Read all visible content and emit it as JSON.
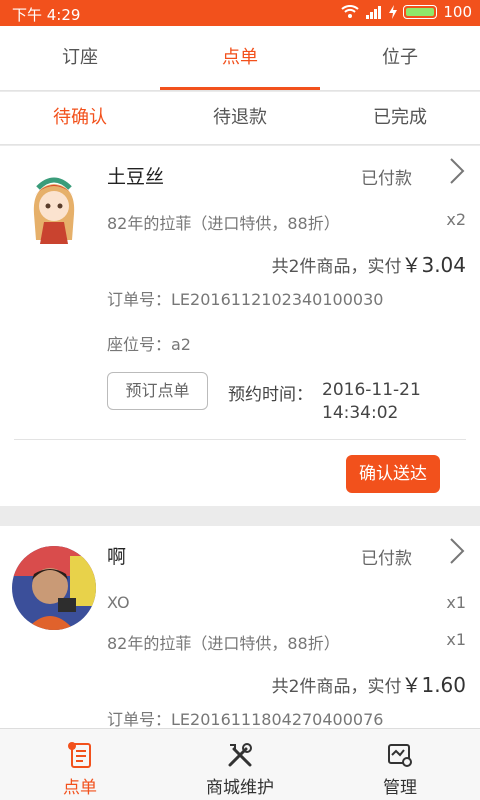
{
  "status_bar": {
    "time": "下午 4:29",
    "battery": "100"
  },
  "top_tabs": [
    {
      "label": "订座",
      "active": false
    },
    {
      "label": "点单",
      "active": true
    },
    {
      "label": "位子",
      "active": false
    }
  ],
  "sub_tabs": [
    {
      "label": "待确认",
      "active": true
    },
    {
      "label": "待退款",
      "active": false
    },
    {
      "label": "已完成",
      "active": false
    }
  ],
  "orders": [
    {
      "name": "土豆丝",
      "status": "已付款",
      "items": [
        {
          "title": "82年的拉菲（进口特供，88折）",
          "qty": "x2"
        }
      ],
      "summary_prefix": "共2件商品，实付",
      "amount": "￥3.04",
      "order_no": "订单号：LE2016112102340100030",
      "seat": "座位号：a2",
      "tag": "预订点单",
      "appt_label": "预约时间：",
      "appt_date": "2016-11-21",
      "appt_time": "14:34:02",
      "confirm": "确认送达"
    },
    {
      "name": "啊",
      "status": "已付款",
      "items": [
        {
          "title": "XO",
          "qty": "x1"
        },
        {
          "title": "82年的拉菲（进口特供，88折）",
          "qty": "x1"
        }
      ],
      "summary_prefix": "共2件商品，实付",
      "amount": "￥1.60",
      "order_no": "订单号：LE2016111804270400076"
    }
  ],
  "bottom_nav": [
    {
      "label": "点单",
      "icon": "order-icon",
      "active": true
    },
    {
      "label": "商城维护",
      "icon": "tools-icon",
      "active": false
    },
    {
      "label": "管理",
      "icon": "manage-icon",
      "active": false
    }
  ],
  "colors": {
    "accent": "#f2511c",
    "battery": "#8ee86a"
  }
}
